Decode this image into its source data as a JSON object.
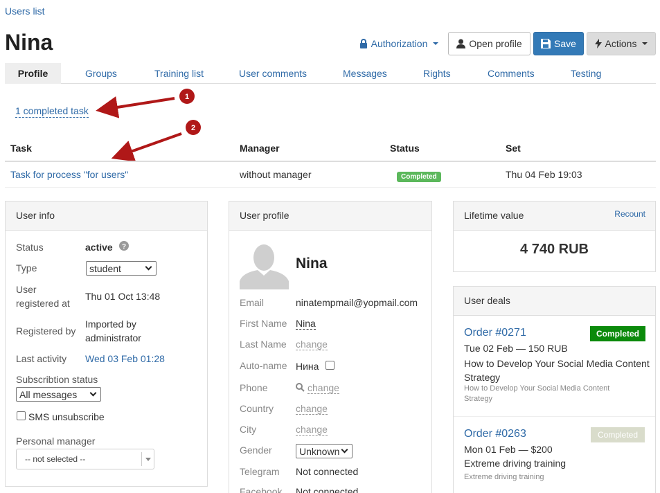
{
  "breadcrumb": "Users list",
  "title": "Nina",
  "header": {
    "authorization": "Authorization",
    "open_profile": "Open profile",
    "save": "Save",
    "actions": "Actions"
  },
  "tabs": [
    "Profile",
    "Groups",
    "Training list",
    "User comments",
    "Messages",
    "Rights",
    "Comments",
    "Testing"
  ],
  "callouts": [
    "1",
    "2"
  ],
  "completed_tasks_link": "1 completed task",
  "task_table": {
    "headers": [
      "Task",
      "Manager",
      "Status",
      "Set"
    ],
    "row": {
      "task": "Task for process \"for users\"",
      "manager": "without manager",
      "status": "Completed",
      "set": "Thu 04 Feb 19:03"
    }
  },
  "user_info": {
    "title": "User info",
    "status_label": "Status",
    "status_value": "active",
    "type_label": "Type",
    "type_value": "student",
    "registered_label_1": "User",
    "registered_label_2": "registered at",
    "registered_value": "Thu 01 Oct 13:48",
    "registered_by_label": "Registered by",
    "registered_by_value_1": "Imported by",
    "registered_by_value_2": "administrator",
    "last_activity_label": "Last activity",
    "last_activity_value": "Wed 03 Feb 01:28",
    "subscription_label": "Subscribtion status",
    "subscription_value": "All messages",
    "sms_label": "SMS unsubscribe",
    "manager_label": "Personal manager",
    "manager_value": "-- not selected --"
  },
  "user_profile": {
    "title": "User profile",
    "name": "Nina",
    "email_label": "Email",
    "email_value": "ninatempmail@yopmail.com",
    "first_name_label": "First Name",
    "first_name_value": "Nina",
    "last_name_label": "Last Name",
    "last_name_value": "change",
    "auto_name_label": "Auto-name",
    "auto_name_value": "Нина",
    "phone_label": "Phone",
    "phone_value": "change",
    "country_label": "Country",
    "country_value": "change",
    "city_label": "City",
    "city_value": "change",
    "gender_label": "Gender",
    "gender_value": "Unknown",
    "telegram_label": "Telegram",
    "telegram_value": "Not connected",
    "facebook_label": "Facebook",
    "facebook_value": "Not connected"
  },
  "lifetime": {
    "title": "Lifetime value",
    "recount": "Recount",
    "value": "4 740 RUB"
  },
  "deals": {
    "title": "User deals",
    "items": [
      {
        "order": "Order #0271",
        "status": "Completed",
        "date_price": "Tue 02 Feb — 150 RUB",
        "name": "How to Develop Your Social Media Content Strategy",
        "sub": "How to Develop Your Social Media Content Strategy"
      },
      {
        "order": "Order #0263",
        "status": "Completed",
        "date_price": "Mon 01 Feb — $200",
        "name": "Extreme driving training",
        "sub": "Extreme driving training"
      }
    ]
  },
  "colors": {
    "link": "#2f6aa7",
    "primary": "#337ab7",
    "success": "#5cb85c",
    "success_dark": "#0b8a0b",
    "muted_badge": "#d9dccb",
    "arrow": "#b01818"
  }
}
